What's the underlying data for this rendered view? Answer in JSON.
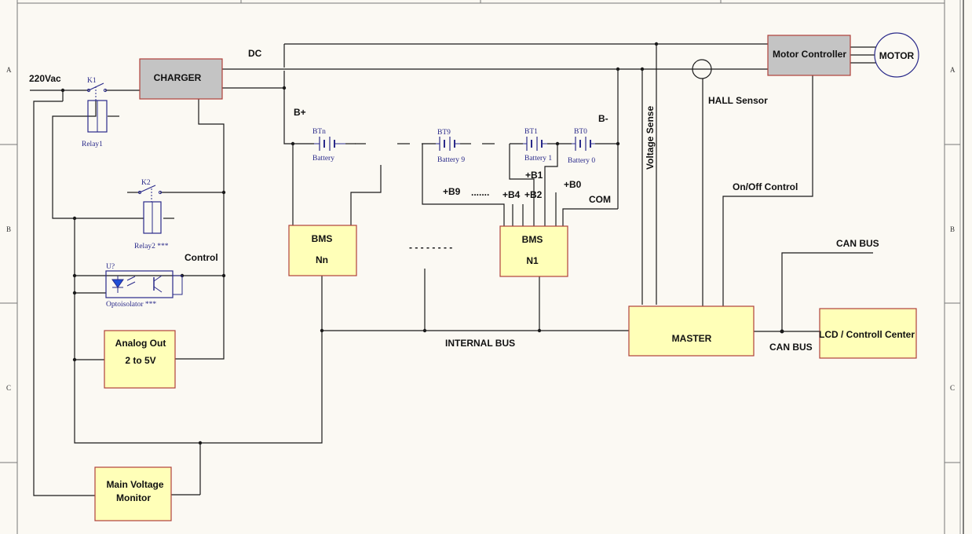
{
  "zones": {
    "left": [
      "A",
      "B",
      "C"
    ],
    "right": [
      "A",
      "B",
      "C"
    ]
  },
  "blocks": {
    "charger": "CHARGER",
    "motor_controller": "Motor Controller",
    "motor": "MOTOR",
    "bms_n": [
      "BMS",
      "Nn"
    ],
    "bms_1": [
      "BMS",
      "N1"
    ],
    "master": "MASTER",
    "lcd": "LCD / Controll Center",
    "analog_out": [
      "Analog Out",
      "2 to 5V"
    ],
    "main_voltage": [
      "Main Voltage",
      "Monitor"
    ]
  },
  "labels": {
    "v220": "220Vac",
    "dc": "DC",
    "b_plus": "B+",
    "b_minus": "B-",
    "control": "Control",
    "hall": "HALL Sensor",
    "voltage_sense": "Voltage Sense",
    "onoff": "On/Off Control",
    "can_bus_top": "CAN BUS",
    "can_bus_bottom": "CAN BUS",
    "internal_bus": "INTERNAL BUS",
    "com": "COM",
    "plus_b9": "+B9",
    "plus_b4": "+B4",
    "plus_b2": "+B2",
    "plus_b1": "+B1",
    "plus_b0": "+B0",
    "dots_small": ".......",
    "dots_mid": "- - - - - - - -"
  },
  "components": {
    "k1": "K1",
    "relay1": "Relay1",
    "k2": "K2",
    "relay2": "Relay2 ***",
    "u": "U?",
    "opto": "Optoisolator ***",
    "btn": "BTn",
    "bt9": "BT9",
    "bt1": "BT1",
    "bt0": "BT0",
    "battery_n": "Battery",
    "battery_9": "Battery 9",
    "battery_1": "Battery 1",
    "battery_0": "Battery 0"
  }
}
